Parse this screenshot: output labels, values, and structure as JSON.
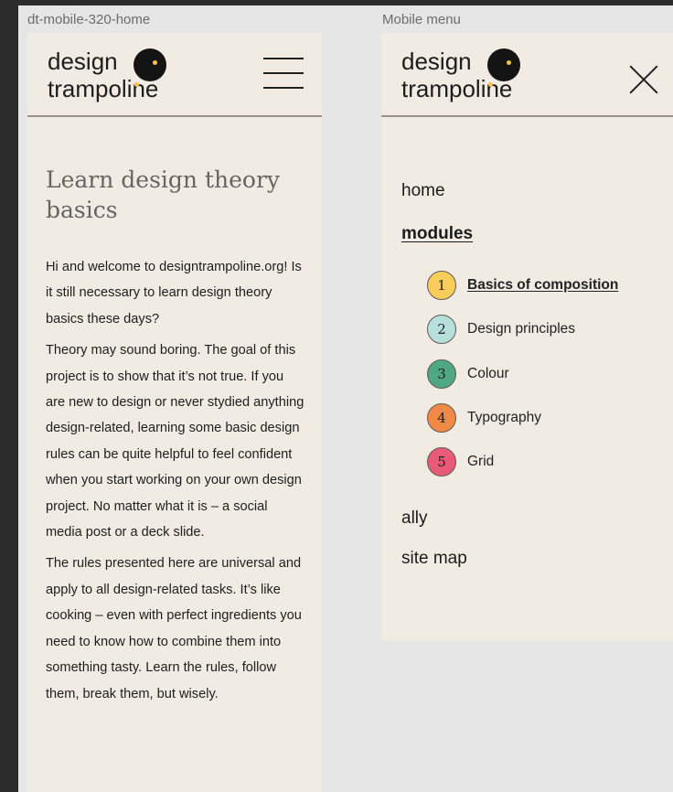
{
  "canvas": {
    "background": "#e6e6e6"
  },
  "frames": {
    "home_label": "dt-mobile-320-home",
    "menu_label": "Mobile menu"
  },
  "logo": {
    "line1": "design",
    "line2": "trampoline",
    "accent_color": "#f6c444"
  },
  "home": {
    "menu_icon": "hamburger-menu-icon",
    "title": "Learn design theory basics",
    "paragraphs": [
      "Hi and welcome to designtrampoline.org! Is it still necessary to learn design theory basics these days?",
      "Theory may sound boring. The goal of this project is to show that it’s not true. If you are new to design or never stydied anything design-related, learning some basic design rules can be quite helpful to feel confident when you start working on your own design project. No matter what it is – a social media post or a deck slide.",
      "The rules presented here are universal and apply to all design-related tasks. It’s like cooking – even with perfect ingredients you need to know how to combine them into something tasty. Learn the rules, follow them, break them, but wisely."
    ]
  },
  "menu": {
    "close_icon": "close-icon",
    "links": {
      "home": "home",
      "modules": "modules",
      "ally": "ally",
      "site_map": "site map"
    },
    "modules": [
      {
        "num": "1",
        "label": "Basics of composition",
        "color": "#f9cd5c",
        "active": true
      },
      {
        "num": "2",
        "label": "Design principles",
        "color": "#b7e0dc",
        "active": false
      },
      {
        "num": "3",
        "label": "Colour",
        "color": "#4fa884",
        "active": false
      },
      {
        "num": "4",
        "label": "Typography",
        "color": "#f08a46",
        "active": false
      },
      {
        "num": "5",
        "label": "Grid",
        "color": "#e85a78",
        "active": false
      }
    ]
  }
}
